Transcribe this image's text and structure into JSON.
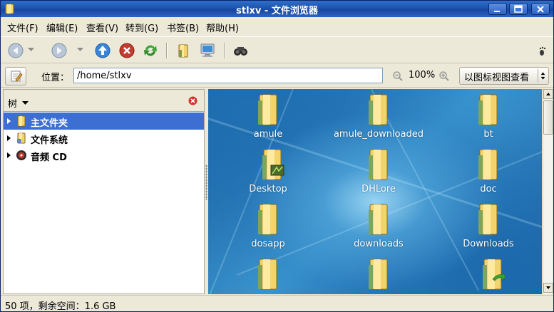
{
  "window": {
    "title": "stlxv - 文件浏览器",
    "title_color": "#1b55b0"
  },
  "menu": [
    {
      "label": "文件(F)"
    },
    {
      "label": "编辑(E)"
    },
    {
      "label": "查看(V)"
    },
    {
      "label": "转到(G)"
    },
    {
      "label": "书签(B)"
    },
    {
      "label": "帮助(H)"
    }
  ],
  "toolbar": {
    "buttons": [
      "back-icon",
      "forward-icon",
      "up-icon",
      "stop-icon",
      "reload-icon",
      "home-icon",
      "computer-icon",
      "search-icon"
    ]
  },
  "location": {
    "label": "位置：",
    "path": "/home/stlxv",
    "zoom": "100%",
    "view_mode": "以图标视图查看"
  },
  "sidepane": {
    "title": "树",
    "items": [
      {
        "label": "主文件夹",
        "icon": "home-folder-icon",
        "selected": true
      },
      {
        "label": "文件系统",
        "icon": "filesystem-icon",
        "selected": false
      },
      {
        "label": "音频 CD",
        "icon": "audio-cd-icon",
        "selected": false
      }
    ]
  },
  "files": [
    {
      "name": "amule",
      "icon": "folder-icon"
    },
    {
      "name": "amule_downloaded",
      "icon": "folder-icon"
    },
    {
      "name": "bt",
      "icon": "folder-icon"
    },
    {
      "name": "Desktop",
      "icon": "desktop-folder-icon"
    },
    {
      "name": "DHLore",
      "icon": "folder-icon"
    },
    {
      "name": "doc",
      "icon": "folder-icon"
    },
    {
      "name": "dosapp",
      "icon": "folder-icon"
    },
    {
      "name": "downloads",
      "icon": "folder-icon"
    },
    {
      "name": "Downloads",
      "icon": "folder-icon"
    },
    {
      "name": "",
      "icon": "folder-icon"
    },
    {
      "name": "",
      "icon": "folder-icon"
    },
    {
      "name": "",
      "icon": "folder-link-icon"
    }
  ],
  "status": {
    "text": "50 项，剩余空间：1.6 GB"
  },
  "colors": {
    "selection": "#3d6fd2",
    "folder": "#f3d36b"
  }
}
